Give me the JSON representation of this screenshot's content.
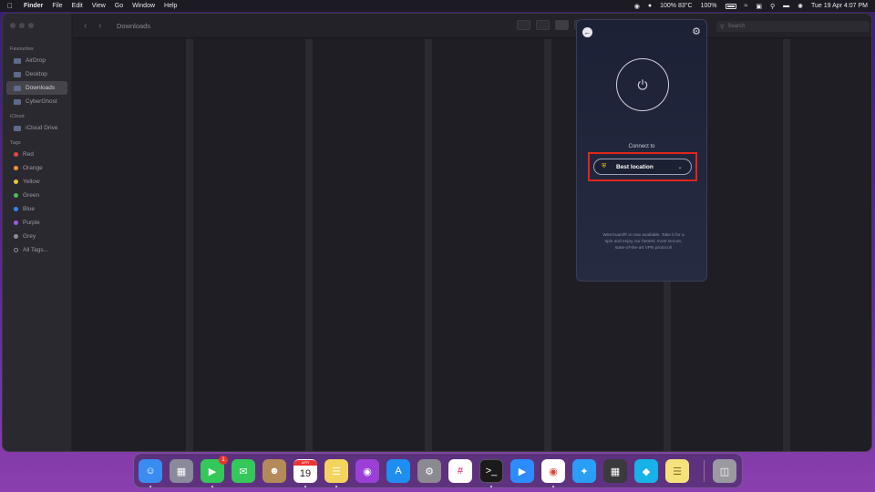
{
  "menubar": {
    "app_name": "Finder",
    "menus": [
      "File",
      "Edit",
      "View",
      "Go",
      "Window",
      "Help"
    ],
    "status_temp": "100% 83°C",
    "status_battery": "100%",
    "datetime": "Tue 19 Apr  4:07 PM"
  },
  "finder": {
    "title": "Downloads",
    "search_placeholder": "Search",
    "sidebar": {
      "favourites_title": "Favourites",
      "favourites": [
        {
          "label": "AirDrop",
          "selected": false
        },
        {
          "label": "Desktop",
          "selected": false
        },
        {
          "label": "Downloads",
          "selected": true
        },
        {
          "label": "CyberGhost",
          "selected": false
        }
      ],
      "icloud_title": "iCloud",
      "icloud": [
        {
          "label": "iCloud Drive"
        }
      ],
      "tags_title": "Tags",
      "tags": [
        {
          "label": "Red",
          "color": "#e0483d"
        },
        {
          "label": "Orange",
          "color": "#f0913a"
        },
        {
          "label": "Yellow",
          "color": "#e8c53a"
        },
        {
          "label": "Green",
          "color": "#4cbc58"
        },
        {
          "label": "Blue",
          "color": "#3a82f0"
        },
        {
          "label": "Purple",
          "color": "#a35ad6"
        },
        {
          "label": "Grey",
          "color": "#8e8e93"
        },
        {
          "label": "All Tags...",
          "color": ""
        }
      ]
    }
  },
  "vpn": {
    "connect_label": "Connect to",
    "location_label": "Best location",
    "wireguard_text": "WireGuard® is now available. Take it for a spin and enjoy our fastest, most secure, state-of-the-art VPN protocol!",
    "highlight_color": "#e0261b",
    "accent_color": "#f5c518"
  },
  "dock": {
    "facetime_badge": "1",
    "calendar_month": "APR",
    "calendar_day": "19",
    "apps": [
      {
        "name": "finder-icon",
        "color": "#3a8cf0"
      },
      {
        "name": "launchpad-icon",
        "color": "#8a8a9a"
      },
      {
        "name": "facetime-icon",
        "color": "#34c759"
      },
      {
        "name": "messages-icon",
        "color": "#34c759"
      },
      {
        "name": "contacts-icon",
        "color": "#b58a5a"
      },
      {
        "name": "calendar-icon",
        "color": "#ffffff"
      },
      {
        "name": "notes-icon",
        "color": "#f4d35e"
      },
      {
        "name": "podcasts-icon",
        "color": "#9b3fd6"
      },
      {
        "name": "app-store-icon",
        "color": "#1e8ef0"
      },
      {
        "name": "system-preferences-icon",
        "color": "#8a8a90"
      },
      {
        "name": "slack-icon",
        "color": "#ffffff"
      },
      {
        "name": "terminal-icon",
        "color": "#1a1a1a"
      },
      {
        "name": "zoom-icon",
        "color": "#2d8cff"
      },
      {
        "name": "chrome-icon",
        "color": "#ffffff"
      },
      {
        "name": "safari-icon",
        "color": "#2a9df4"
      },
      {
        "name": "calculator-icon",
        "color": "#3a3a3c"
      },
      {
        "name": "kodi-icon",
        "color": "#17b2e7"
      },
      {
        "name": "stickies-icon",
        "color": "#f6e27a"
      },
      {
        "name": "trash-icon",
        "color": "#9a9aa0"
      }
    ]
  }
}
